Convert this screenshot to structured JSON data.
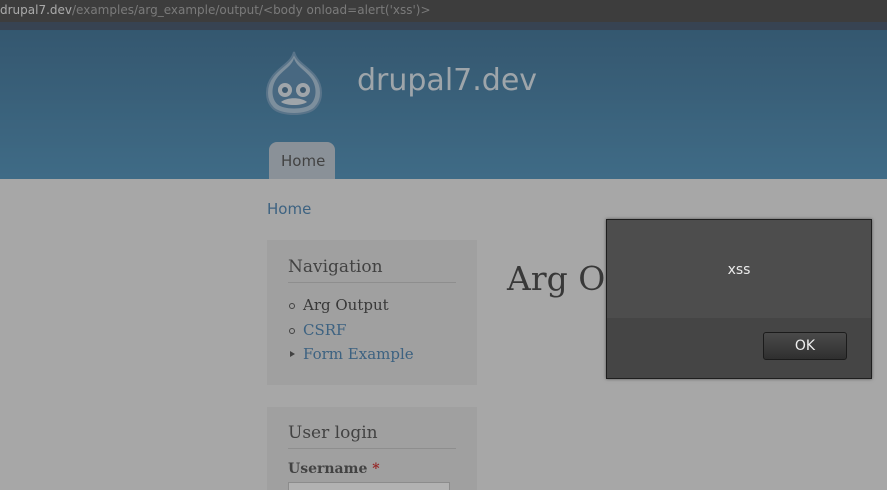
{
  "browser": {
    "url_host": "drupal7.dev",
    "url_path": "/examples/arg_example/output/<body onload=alert('xss')>"
  },
  "header": {
    "site_name": "drupal7.dev",
    "tabs": [
      {
        "label": "Home",
        "active": true
      }
    ]
  },
  "breadcrumb": {
    "home_label": "Home"
  },
  "navigation": {
    "title": "Navigation",
    "items": [
      {
        "label": "Arg Output",
        "state": "active",
        "bullet": "circle"
      },
      {
        "label": "CSRF",
        "state": "link",
        "bullet": "circle"
      },
      {
        "label": "Form Example",
        "state": "link",
        "bullet": "collapsed-arrow"
      }
    ]
  },
  "user_login": {
    "title": "User login",
    "username_label": "Username",
    "required_marker": "*",
    "username_value": ""
  },
  "main": {
    "title_visible_part": "Arg Ou"
  },
  "alert_dialog": {
    "message": "xss",
    "ok_label": "OK"
  },
  "colors": {
    "link": "#2a6ea6",
    "header_top": "#1b5a86",
    "header_bottom": "#2f7fb0",
    "dialog_bg": "#4a4a4a"
  },
  "icons": {
    "logo": "drupal-drop-icon",
    "nav_bullet": "circle-bullet-icon",
    "nav_collapsed": "triangle-right-icon"
  }
}
